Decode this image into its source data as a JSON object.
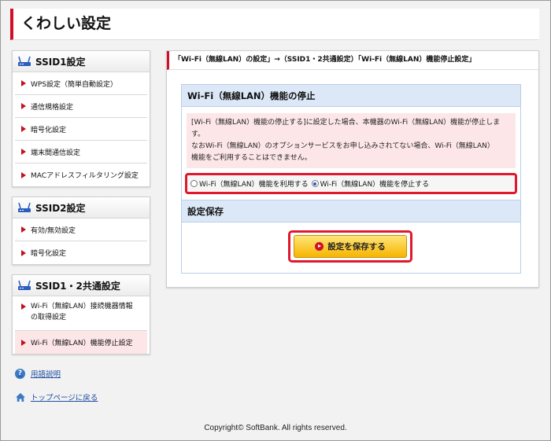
{
  "header": {
    "title": "くわしい設定"
  },
  "sidebar": {
    "ssid1": {
      "title": "SSID1設定",
      "icon": "router-icon",
      "items": [
        {
          "label": "WPS設定（簡単自動設定）"
        },
        {
          "label": "通信規格設定"
        },
        {
          "label": "暗号化設定"
        },
        {
          "label": "端末間通信設定"
        },
        {
          "label": "MACアドレスフィルタリング設定"
        }
      ]
    },
    "ssid2": {
      "title": "SSID2設定",
      "icon": "router-icon",
      "items": [
        {
          "label": "有効/無効設定"
        },
        {
          "label": "暗号化設定"
        }
      ]
    },
    "common": {
      "title": "SSID1・2共通設定",
      "icon": "router-icon",
      "items": [
        {
          "label1": "Wi-Fi（無線LAN）接続機器情報",
          "label2": "の取得設定"
        },
        {
          "label": "Wi-Fi（無線LAN）機能停止設定",
          "active": true
        }
      ]
    },
    "links": {
      "glossary": "用語説明",
      "top": "トップページに戻る"
    }
  },
  "main": {
    "breadcrumb": "「Wi-Fi（無線LAN）の設定」→（SSID1・2共通設定）「Wi-Fi（無線LAN）機能停止設定」",
    "stop_panel": {
      "title": "Wi-Fi（無線LAN）機能の停止",
      "warning_line1": "[Wi-Fi（無線LAN）機能の停止する]に設定した場合、本機器のWi-Fi（無線LAN）機能が停止しま",
      "warning_line2": "す。",
      "warning_line3": "なおWi-Fi（無線LAN）のオプションサービスをお申し込みされてない場合、Wi-Fi（無線LAN）",
      "warning_line4": "機能をご利用することはできません。",
      "option_use": "Wi-Fi（無線LAN）機能を利用する",
      "option_stop": "Wi-Fi（無線LAN）機能を停止する",
      "selected": "stop"
    },
    "save_panel": {
      "title": "設定保存",
      "button": "設定を保存する"
    }
  },
  "footer": {
    "copyright": "Copyright© SoftBank. All rights reserved."
  },
  "colors": {
    "accent": "#d0102a",
    "highlight": "#e0182d",
    "panel_head": "#dce8f7",
    "button": "#f6b500"
  }
}
